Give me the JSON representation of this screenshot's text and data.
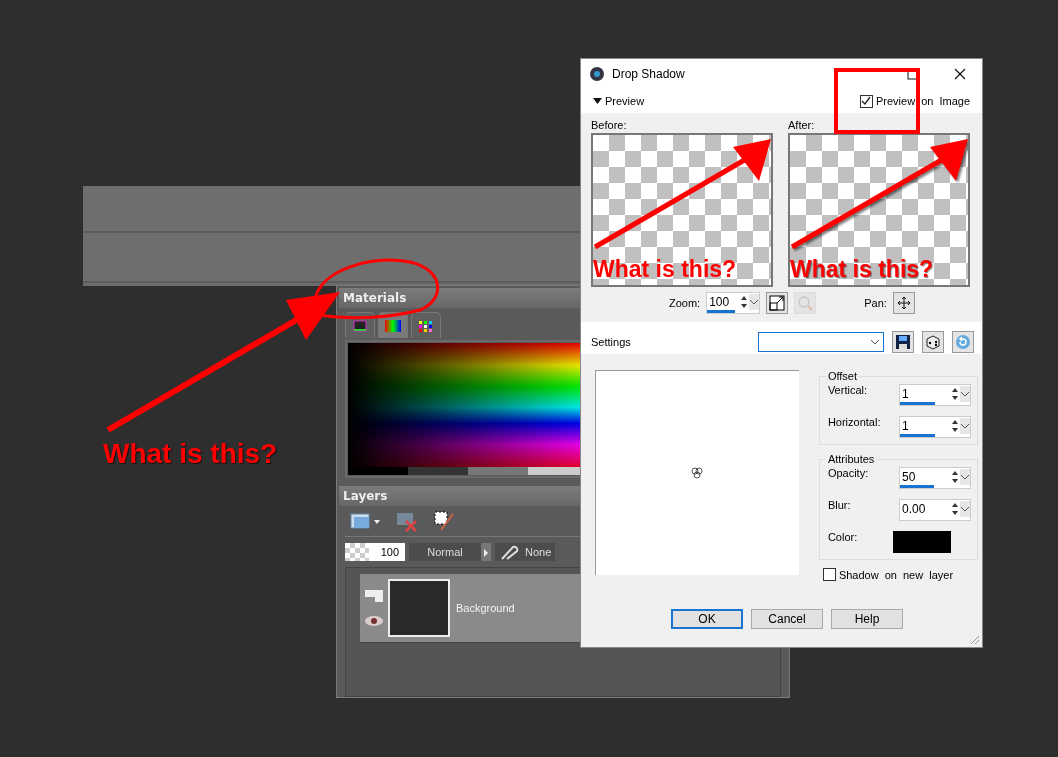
{
  "materials_panel": {
    "title": "Materials",
    "tabs": [
      {
        "kind": "frame",
        "selected": false
      },
      {
        "kind": "spectrum",
        "selected": true
      },
      {
        "kind": "swatches",
        "selected": false
      }
    ]
  },
  "layers_panel": {
    "title": "Layers",
    "opacity": "100",
    "blend_mode": "Normal",
    "mask": "None",
    "layers": [
      {
        "name": "Background",
        "visible": true
      }
    ]
  },
  "dialog": {
    "title": "Drop Shadow",
    "preview_toggle": {
      "label": "Preview",
      "expanded": true
    },
    "preview_on_image": {
      "label": "Preview on Image",
      "checked": true
    },
    "previews": [
      {
        "label": "Before:",
        "caption": "What is this?",
        "shadow": false
      },
      {
        "label": "After:",
        "caption": "What is this?",
        "shadow": true
      }
    ],
    "zoom": {
      "label": "Zoom:",
      "value": "100",
      "level": 0.54
    },
    "pan_label": "Pan:",
    "settings_label": "Settings",
    "groups": [
      {
        "title": "Offset",
        "fields": [
          {
            "kind": "spin",
            "label": "Vertical:",
            "value": "1",
            "level": 0.5
          },
          {
            "kind": "spin",
            "label": "Horizontal:",
            "value": "1",
            "level": 0.5
          }
        ]
      },
      {
        "title": "Attributes",
        "fields": [
          {
            "kind": "spin",
            "label": "Opacity:",
            "value": "50",
            "level": 0.49
          },
          {
            "kind": "spin",
            "label": "Blur:",
            "value": "0.00"
          },
          {
            "kind": "color",
            "label": "Color:",
            "color": "#000000"
          }
        ]
      }
    ],
    "new_layer": {
      "label": "Shadow on new layer",
      "checked": false
    },
    "buttons": [
      {
        "label": "OK",
        "default": true
      },
      {
        "label": "Cancel",
        "default": false
      },
      {
        "label": "Help",
        "default": false
      }
    ]
  },
  "annotations": [
    {
      "kind": "callout_text",
      "text": "What is this?"
    }
  ]
}
